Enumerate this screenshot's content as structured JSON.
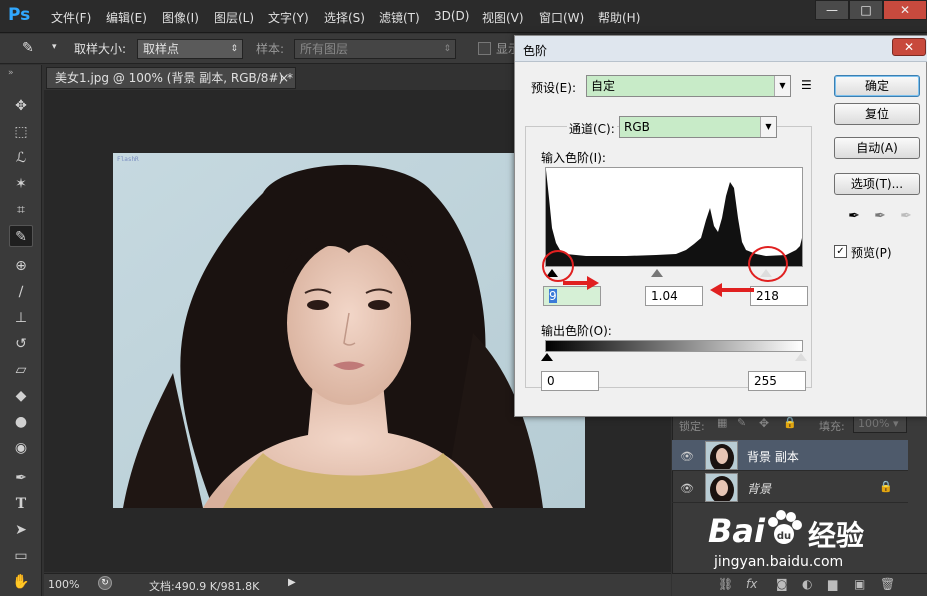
{
  "app": {
    "logo": "Ps",
    "menu": [
      "文件(F)",
      "编辑(E)",
      "图像(I)",
      "图层(L)",
      "文字(Y)",
      "选择(S)",
      "滤镜(T)",
      "3D(D)",
      "视图(V)",
      "窗口(W)",
      "帮助(H)"
    ],
    "window_controls": [
      "—",
      "□",
      "✕"
    ]
  },
  "options_bar": {
    "sample_size_label": "取样大小:",
    "sample_size_value": "取样点",
    "sample_label": "样本:",
    "sample_value": "所有图层",
    "show_label": "显示"
  },
  "document": {
    "tab_title": "美女1.jpg @ 100% (背景 副本, RGB/8#) *",
    "tab_close": "×",
    "watermark": "FlashR",
    "zoom": "100%",
    "doc_info": "文档:490.9 K/981.8K"
  },
  "layers_panel": {
    "lock_label": "锁定:",
    "fill_label": "填充:",
    "fill_value": "100%",
    "layers": [
      {
        "name": "背景 副本",
        "selected": true,
        "locked": false
      },
      {
        "name": "背景",
        "selected": false,
        "locked": true
      }
    ]
  },
  "levels_dialog": {
    "title": "色阶",
    "close": "✕",
    "preset_label": "预设(E):",
    "preset_value": "自定",
    "channel_label": "通道(C):",
    "channel_value": "RGB",
    "input_levels_label": "输入色阶(I):",
    "output_levels_label": "输出色阶(O):",
    "input_black": "9",
    "input_gamma": "1.04",
    "input_white": "218",
    "output_black": "0",
    "output_white": "255",
    "buttons": {
      "ok": "确定",
      "reset": "复位",
      "auto": "自动(A)",
      "options": "选项(T)..."
    },
    "preview_label": "预览(P)",
    "preview_checked": true,
    "checkmark": "✓"
  },
  "watermark_site": {
    "brand": "Bai",
    "brand2": "du",
    "brand_cn": "经验",
    "url": "jingyan.baidu.com"
  },
  "colors": {
    "accent_red": "#e02020",
    "combo_green": "#c8ebc8",
    "selected_layer": "#4e5a6b"
  }
}
